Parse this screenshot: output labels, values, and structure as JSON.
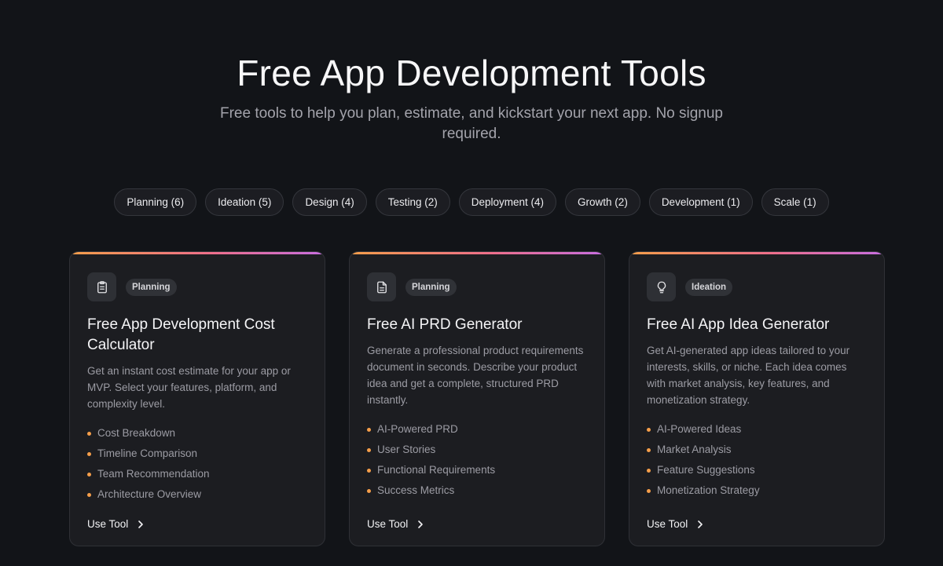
{
  "hero": {
    "title": "Free App Development Tools",
    "subtitle": "Free tools to help you plan, estimate, and kickstart your next app. No signup required."
  },
  "filters": [
    "Planning (6)",
    "Ideation (5)",
    "Design (4)",
    "Testing (2)",
    "Deployment (4)",
    "Growth (2)",
    "Development (1)",
    "Scale (1)"
  ],
  "colors": {
    "background": "#121418",
    "card": "#1c1d21",
    "accent_orange": "#f59e4a",
    "accent_pink": "#ee6f8a",
    "accent_purple": "#c76ee0"
  },
  "cards": [
    {
      "icon": "clipboard-icon",
      "tag": "Planning",
      "title": "Free App Development Cost Calculator",
      "description": "Get an instant cost estimate for your app or MVP. Select your features, platform, and complexity level.",
      "features": [
        "Cost Breakdown",
        "Timeline Comparison",
        "Team Recommendation",
        "Architecture Overview"
      ],
      "cta": "Use Tool"
    },
    {
      "icon": "document-icon",
      "tag": "Planning",
      "title": "Free AI PRD Generator",
      "description": "Generate a professional product requirements document in seconds. Describe your product idea and get a complete, structured PRD instantly.",
      "features": [
        "AI-Powered PRD",
        "User Stories",
        "Functional Requirements",
        "Success Metrics"
      ],
      "cta": "Use Tool"
    },
    {
      "icon": "lightbulb-icon",
      "tag": "Ideation",
      "title": "Free AI App Idea Generator",
      "description": "Get AI-generated app ideas tailored to your interests, skills, or niche. Each idea comes with market analysis, key features, and monetization strategy.",
      "features": [
        "AI-Powered Ideas",
        "Market Analysis",
        "Feature Suggestions",
        "Monetization Strategy"
      ],
      "cta": "Use Tool"
    }
  ]
}
